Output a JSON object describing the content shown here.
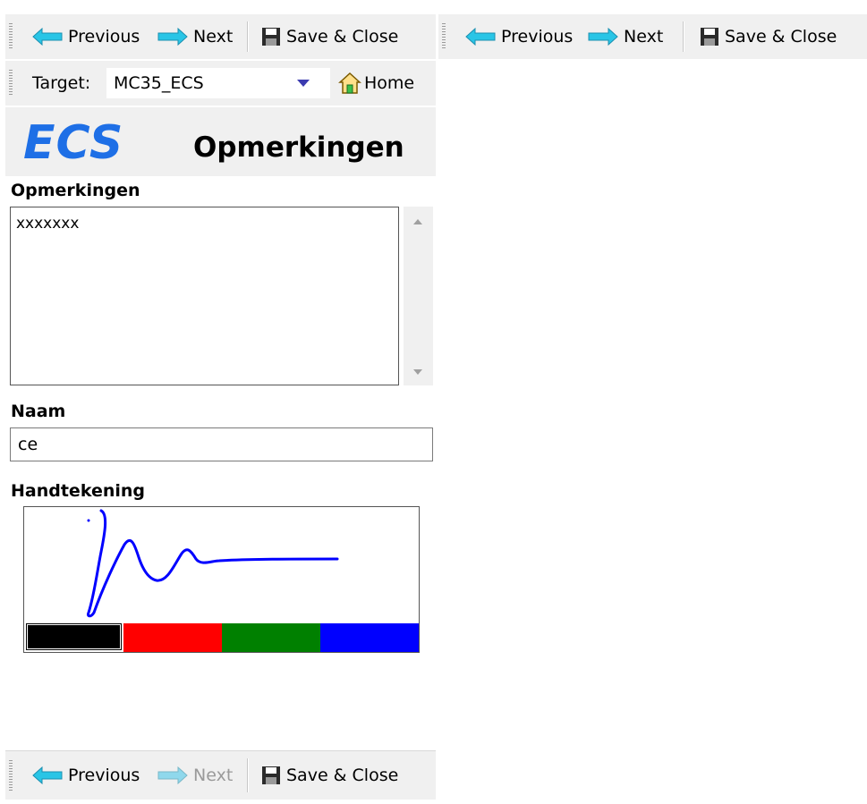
{
  "nav": {
    "previous": "Previous",
    "next": "Next",
    "save_close": "Save & Close"
  },
  "target": {
    "label": "Target:",
    "value": "MC35_ECS",
    "home": "Home"
  },
  "header": {
    "logo": "ECS",
    "title": "Opmerkingen"
  },
  "form": {
    "remarks_label": "Opmerkingen",
    "remarks_value": "xxxxxxx",
    "name_label": "Naam",
    "name_value": "ce",
    "signature_label": "Handtekening"
  },
  "pen_colors": {
    "black": "#000000",
    "red": "#ff0000",
    "green": "#008000",
    "blue": "#0000ff",
    "selected": "black"
  },
  "colors": {
    "arrow": "#29c5e6",
    "logo": "#1e6fe6",
    "toolbar_bg": "#f0f0f0"
  }
}
